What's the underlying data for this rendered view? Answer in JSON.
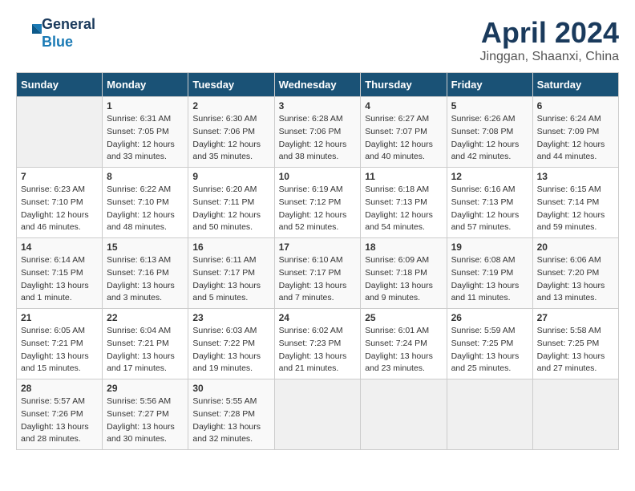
{
  "header": {
    "logo_line1": "General",
    "logo_line2": "Blue",
    "title": "April 2024",
    "subtitle": "Jinggan, Shaanxi, China"
  },
  "calendar": {
    "days_of_week": [
      "Sunday",
      "Monday",
      "Tuesday",
      "Wednesday",
      "Thursday",
      "Friday",
      "Saturday"
    ],
    "weeks": [
      [
        {
          "day": "",
          "content": ""
        },
        {
          "day": "1",
          "content": "Sunrise: 6:31 AM\nSunset: 7:05 PM\nDaylight: 12 hours\nand 33 minutes."
        },
        {
          "day": "2",
          "content": "Sunrise: 6:30 AM\nSunset: 7:06 PM\nDaylight: 12 hours\nand 35 minutes."
        },
        {
          "day": "3",
          "content": "Sunrise: 6:28 AM\nSunset: 7:06 PM\nDaylight: 12 hours\nand 38 minutes."
        },
        {
          "day": "4",
          "content": "Sunrise: 6:27 AM\nSunset: 7:07 PM\nDaylight: 12 hours\nand 40 minutes."
        },
        {
          "day": "5",
          "content": "Sunrise: 6:26 AM\nSunset: 7:08 PM\nDaylight: 12 hours\nand 42 minutes."
        },
        {
          "day": "6",
          "content": "Sunrise: 6:24 AM\nSunset: 7:09 PM\nDaylight: 12 hours\nand 44 minutes."
        }
      ],
      [
        {
          "day": "7",
          "content": "Sunrise: 6:23 AM\nSunset: 7:10 PM\nDaylight: 12 hours\nand 46 minutes."
        },
        {
          "day": "8",
          "content": "Sunrise: 6:22 AM\nSunset: 7:10 PM\nDaylight: 12 hours\nand 48 minutes."
        },
        {
          "day": "9",
          "content": "Sunrise: 6:20 AM\nSunset: 7:11 PM\nDaylight: 12 hours\nand 50 minutes."
        },
        {
          "day": "10",
          "content": "Sunrise: 6:19 AM\nSunset: 7:12 PM\nDaylight: 12 hours\nand 52 minutes."
        },
        {
          "day": "11",
          "content": "Sunrise: 6:18 AM\nSunset: 7:13 PM\nDaylight: 12 hours\nand 54 minutes."
        },
        {
          "day": "12",
          "content": "Sunrise: 6:16 AM\nSunset: 7:13 PM\nDaylight: 12 hours\nand 57 minutes."
        },
        {
          "day": "13",
          "content": "Sunrise: 6:15 AM\nSunset: 7:14 PM\nDaylight: 12 hours\nand 59 minutes."
        }
      ],
      [
        {
          "day": "14",
          "content": "Sunrise: 6:14 AM\nSunset: 7:15 PM\nDaylight: 13 hours\nand 1 minute."
        },
        {
          "day": "15",
          "content": "Sunrise: 6:13 AM\nSunset: 7:16 PM\nDaylight: 13 hours\nand 3 minutes."
        },
        {
          "day": "16",
          "content": "Sunrise: 6:11 AM\nSunset: 7:17 PM\nDaylight: 13 hours\nand 5 minutes."
        },
        {
          "day": "17",
          "content": "Sunrise: 6:10 AM\nSunset: 7:17 PM\nDaylight: 13 hours\nand 7 minutes."
        },
        {
          "day": "18",
          "content": "Sunrise: 6:09 AM\nSunset: 7:18 PM\nDaylight: 13 hours\nand 9 minutes."
        },
        {
          "day": "19",
          "content": "Sunrise: 6:08 AM\nSunset: 7:19 PM\nDaylight: 13 hours\nand 11 minutes."
        },
        {
          "day": "20",
          "content": "Sunrise: 6:06 AM\nSunset: 7:20 PM\nDaylight: 13 hours\nand 13 minutes."
        }
      ],
      [
        {
          "day": "21",
          "content": "Sunrise: 6:05 AM\nSunset: 7:21 PM\nDaylight: 13 hours\nand 15 minutes."
        },
        {
          "day": "22",
          "content": "Sunrise: 6:04 AM\nSunset: 7:21 PM\nDaylight: 13 hours\nand 17 minutes."
        },
        {
          "day": "23",
          "content": "Sunrise: 6:03 AM\nSunset: 7:22 PM\nDaylight: 13 hours\nand 19 minutes."
        },
        {
          "day": "24",
          "content": "Sunrise: 6:02 AM\nSunset: 7:23 PM\nDaylight: 13 hours\nand 21 minutes."
        },
        {
          "day": "25",
          "content": "Sunrise: 6:01 AM\nSunset: 7:24 PM\nDaylight: 13 hours\nand 23 minutes."
        },
        {
          "day": "26",
          "content": "Sunrise: 5:59 AM\nSunset: 7:25 PM\nDaylight: 13 hours\nand 25 minutes."
        },
        {
          "day": "27",
          "content": "Sunrise: 5:58 AM\nSunset: 7:25 PM\nDaylight: 13 hours\nand 27 minutes."
        }
      ],
      [
        {
          "day": "28",
          "content": "Sunrise: 5:57 AM\nSunset: 7:26 PM\nDaylight: 13 hours\nand 28 minutes."
        },
        {
          "day": "29",
          "content": "Sunrise: 5:56 AM\nSunset: 7:27 PM\nDaylight: 13 hours\nand 30 minutes."
        },
        {
          "day": "30",
          "content": "Sunrise: 5:55 AM\nSunset: 7:28 PM\nDaylight: 13 hours\nand 32 minutes."
        },
        {
          "day": "",
          "content": ""
        },
        {
          "day": "",
          "content": ""
        },
        {
          "day": "",
          "content": ""
        },
        {
          "day": "",
          "content": ""
        }
      ]
    ]
  }
}
